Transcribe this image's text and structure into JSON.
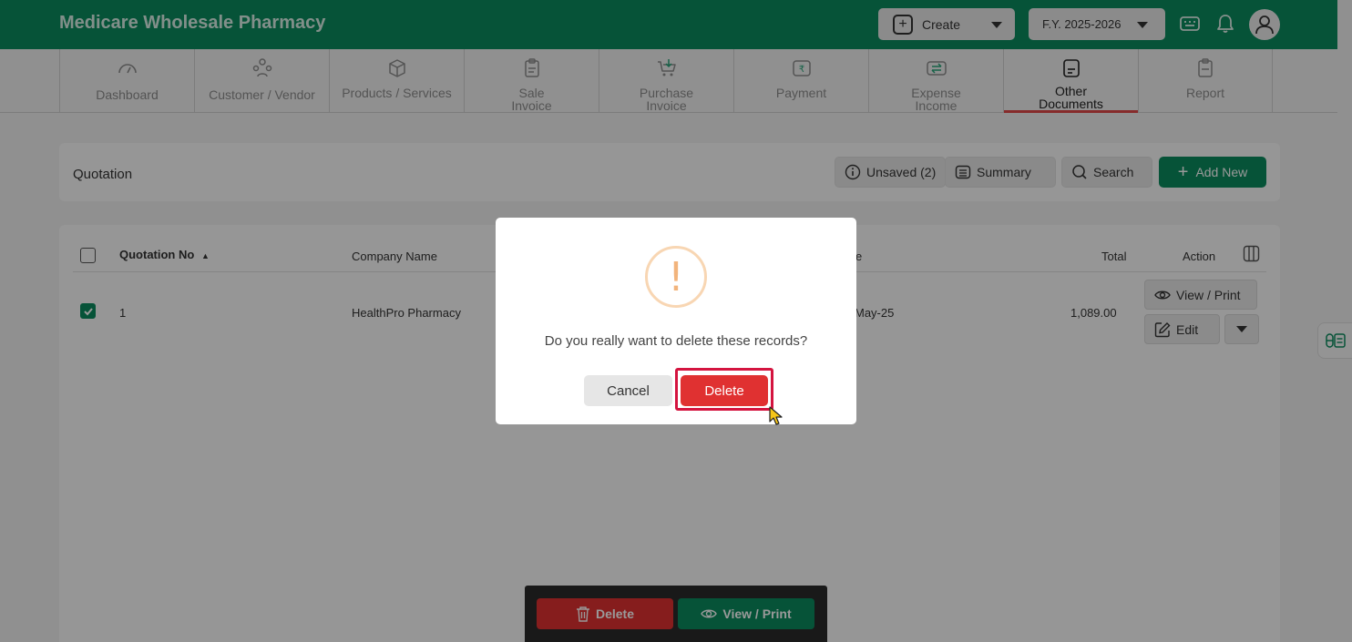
{
  "app": {
    "title": "Medicare Wholesale Pharmacy"
  },
  "topbar": {
    "create_label": "Create",
    "fiscal_year": "F.Y. 2025-2026"
  },
  "nav": {
    "tabs": [
      {
        "label": "Dashboard"
      },
      {
        "label": "Customer / Vendor"
      },
      {
        "label": "Products / Services"
      },
      {
        "label_line1": "Sale",
        "label_line2": "Invoice"
      },
      {
        "label_line1": "Purchase",
        "label_line2": "Invoice"
      },
      {
        "label": "Payment"
      },
      {
        "label_line1": "Expense",
        "label_line2": "Income"
      },
      {
        "label_line1": "Other",
        "label_line2": "Documents",
        "active": true
      },
      {
        "label": "Report"
      }
    ]
  },
  "header": {
    "title": "Quotation",
    "unsaved_label": "Unsaved (2)",
    "summary_label": "Summary",
    "search_label": "Search",
    "add_new_label": "Add New"
  },
  "table": {
    "columns": {
      "quotation_no": "Quotation No",
      "company_name": "Company Name",
      "date_partial": "e",
      "total": "Total",
      "action": "Action"
    },
    "rows": [
      {
        "checked": true,
        "quotation_no": "1",
        "company_name": "HealthPro Pharmacy",
        "date_partial": "May-25",
        "total": "1,089.00",
        "view_print_label": "View / Print",
        "edit_label": "Edit"
      }
    ]
  },
  "bottom_bar": {
    "delete_label": "Delete",
    "view_print_label": "View / Print"
  },
  "dialog": {
    "icon_glyph": "!",
    "message": "Do you really want to delete these records?",
    "cancel_label": "Cancel",
    "delete_label": "Delete"
  },
  "colors": {
    "brand": "#0a8b5e",
    "danger": "#e03131",
    "warning_icon": "#f2b47c"
  }
}
